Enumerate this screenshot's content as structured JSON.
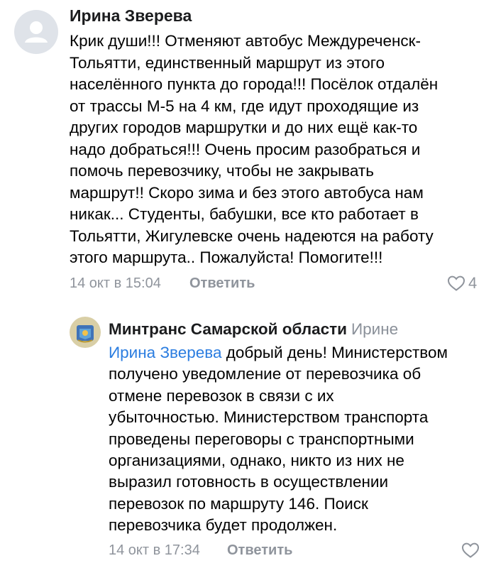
{
  "comments": [
    {
      "author": "Ирина Зверева",
      "avatar_icon": "default-user-avatar-icon",
      "text_lines": [
        "Крик души!!! Отменяют автобус Междуреченск-",
        "Тольятти, единственный маршрут из этого",
        "населённого пункта до города!!! Посёлок отдалён",
        "от трассы М-5 на 4 км, где идут проходящие из",
        "других городов маршрутки и до них ещё как-то",
        "надо добраться!!! Очень просим разобраться и",
        "помочь перевозчику, чтобы не закрывать",
        "маршрут!! Скоро зима и без этого автобуса нам",
        "никак... Студенты, бабушки, все кто работает в",
        "Тольятти, Жигулевске очень надеются на работу",
        "этого маршрута.. Пожалуйста! Помогите!!!"
      ],
      "timestamp": "14 окт в 15:04",
      "reply_label": "Ответить",
      "likes": "4"
    },
    {
      "author": "Минтранс Самарской области",
      "reply_to": "Ирине",
      "avatar_icon": "ministry-emblem-avatar-icon",
      "mention": "Ирина Зверева",
      "text_first_line_rest": " добрый день! Министерством",
      "text_lines": [
        "получено уведомление от перевозчика об",
        "отмене перевозок в связи с их",
        "убыточностью. Министерством транспорта",
        "проведены переговоры с транспортными",
        "организациями, однако, никто из них не",
        "выразил готовность в осуществлении",
        "перевозок по маршруту 146.  Поиск",
        "перевозчика будет продолжен."
      ],
      "timestamp": "14 окт в 17:34",
      "reply_label": "Ответить",
      "likes": ""
    }
  ],
  "colors": {
    "mention": "#2b7de0",
    "meta": "#8f949c",
    "author": "#1b1c1e",
    "avatar_bg": "#dfe3e9"
  }
}
